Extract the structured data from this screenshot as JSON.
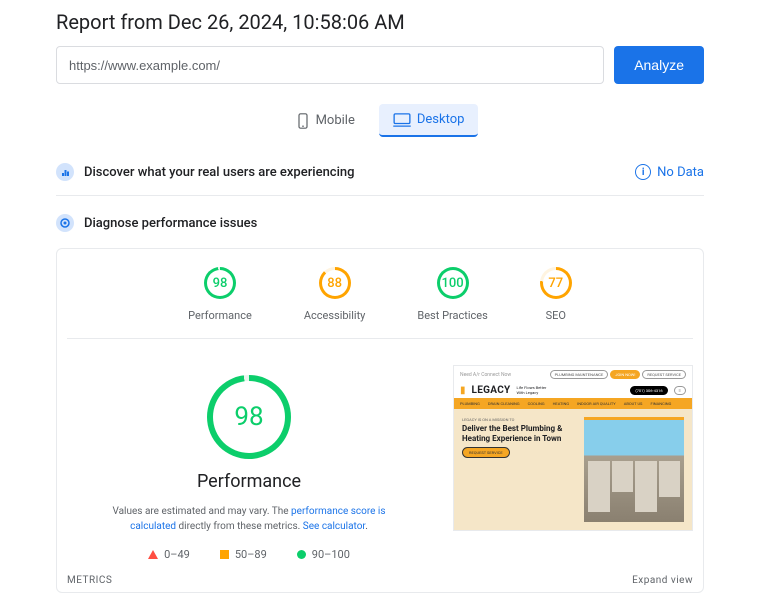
{
  "header": {
    "report_title": "Report from Dec 26, 2024, 10:58:06 AM",
    "url_value": "https://www.example.com/",
    "analyze_label": "Analyze"
  },
  "tabs": {
    "mobile_label": "Mobile",
    "desktop_label": "Desktop"
  },
  "discover": {
    "title": "Discover what your real users are experiencing",
    "no_data_label": "No Data"
  },
  "diagnose": {
    "title": "Diagnose performance issues"
  },
  "gauges": [
    {
      "label": "Performance",
      "value": "98"
    },
    {
      "label": "Accessibility",
      "value": "88"
    },
    {
      "label": "Best Practices",
      "value": "100"
    },
    {
      "label": "SEO",
      "value": "77"
    }
  ],
  "main": {
    "big_score": "98",
    "big_label": "Performance",
    "desc_prefix": "Values are estimated and may vary. The ",
    "desc_link1": "performance score is calculated",
    "desc_mid": " directly from these metrics. ",
    "desc_link2": "See calculator",
    "desc_suffix": "."
  },
  "legend": {
    "poor": "0–49",
    "avg": "50–89",
    "good": "90–100"
  },
  "preview": {
    "topbar_text": "Need A/r Connect Now",
    "pill1": "PLUMBING MAINTENANCE",
    "pill2": "JOIN NOW!",
    "pill3": "REQUEST SERVICE",
    "phone": "(701) 306-4316",
    "logo": "LEGACY",
    "tagline1": "Life Flows Better",
    "tagline2": "With Legacy",
    "nav": [
      "PLUMBING",
      "DRAIN CLEANING",
      "COOLING",
      "HEATING",
      "INDOOR AIR QUALITY",
      "ABOUT US",
      "FINANCING"
    ],
    "hero_sub": "LEGACY IS ON A MISSION TO",
    "hero_title": "Deliver the Best Plumbing & Heating Experience in Town",
    "hero_cta": "REQUEST SERVICE"
  },
  "footer": {
    "metrics": "METRICS",
    "expand": "Expand view"
  }
}
